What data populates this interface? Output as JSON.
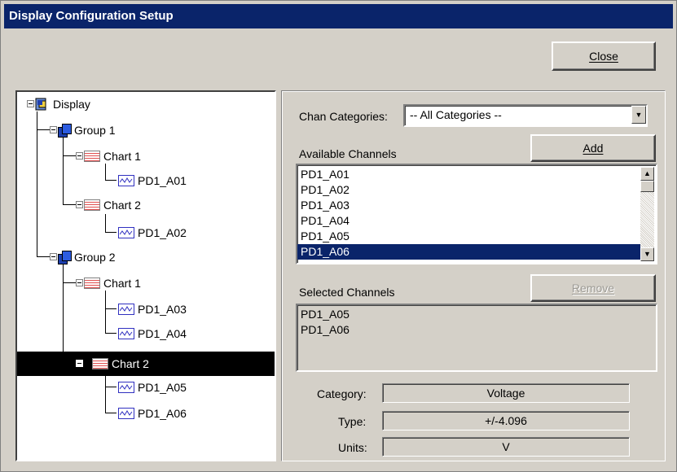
{
  "window": {
    "title": "Display Configuration Setup"
  },
  "close_button": {
    "label": "Close"
  },
  "tree": {
    "root": "Display",
    "group1": "Group 1",
    "g1_chart1": "Chart 1",
    "g1_chart1_ch": "PD1_A01",
    "g1_chart2": "Chart 2",
    "g1_chart2_ch": "PD1_A02",
    "group2": "Group 2",
    "g2_chart1": "Chart 1",
    "g2_chart1_ch1": "PD1_A03",
    "g2_chart1_ch2": "PD1_A04",
    "g2_chart2": "Chart 2",
    "g2_chart2_ch1": "PD1_A05",
    "g2_chart2_ch2": "PD1_A06",
    "selected": "g2_chart2"
  },
  "chan_categories": {
    "label": "Chan Categories:",
    "value": "-- All Categories --"
  },
  "available": {
    "label": "Available Channels",
    "add_label": "Add",
    "items": [
      "PD1_A01",
      "PD1_A02",
      "PD1_A03",
      "PD1_A04",
      "PD1_A05",
      "PD1_A06"
    ],
    "selected_index": 5
  },
  "selected_channels": {
    "label": "Selected Channels",
    "remove_label": "Remove",
    "items": [
      "PD1_A05",
      "PD1_A06"
    ]
  },
  "properties": {
    "category_label": "Category:",
    "category_value": "Voltage",
    "type_label": "Type:",
    "type_value": "+/-4.096",
    "units_label": "Units:",
    "units_value": "V"
  },
  "colors": {
    "selection": "#0a246a",
    "titlebar": "#0a246a",
    "face": "#d4d0c8"
  }
}
